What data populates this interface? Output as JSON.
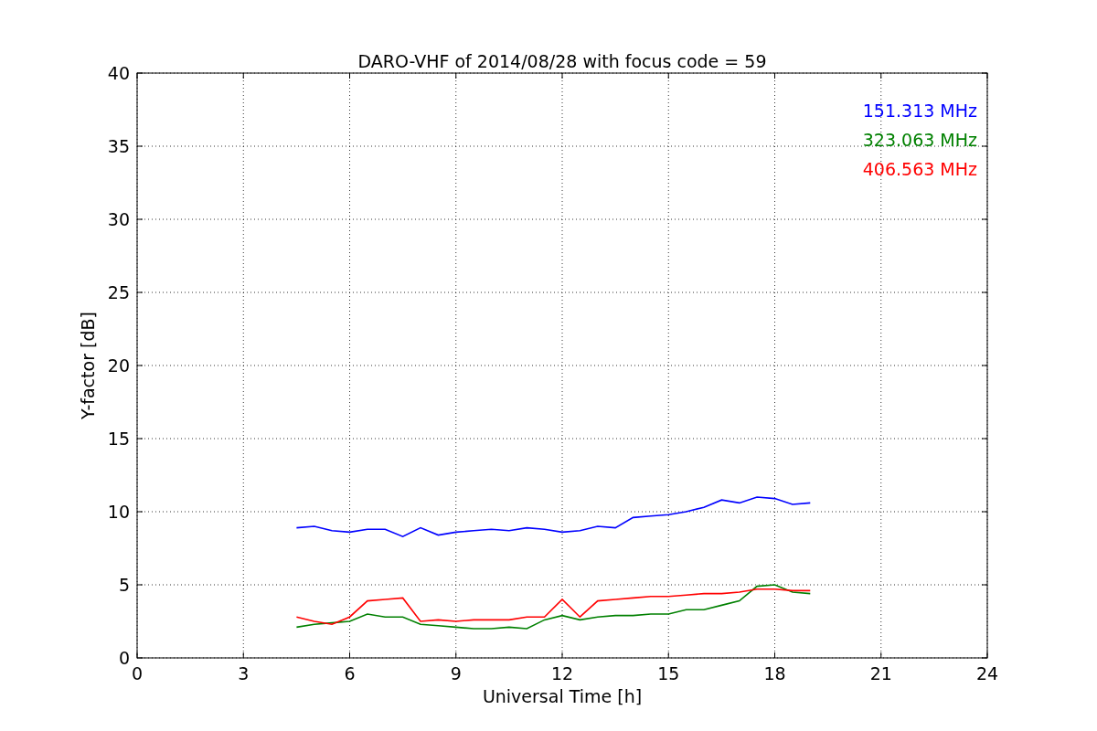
{
  "chart_data": {
    "type": "line",
    "title": "DARO-VHF of 2014/08/28 with focus code = 59",
    "xlabel": "Universal Time [h]",
    "ylabel": "Y-factor [dB]",
    "x": [
      4.5,
      5,
      5.5,
      6,
      6.5,
      7,
      7.5,
      8,
      8.5,
      9,
      9.5,
      10,
      10.5,
      11,
      11.5,
      12,
      12.5,
      13,
      13.5,
      14,
      14.5,
      15,
      15.5,
      16,
      16.5,
      17,
      17.5,
      18,
      18.5,
      19
    ],
    "series": [
      {
        "name": "151.313 MHz",
        "color": "#0000ff",
        "values": [
          8.9,
          9.0,
          8.7,
          8.6,
          8.8,
          8.8,
          8.3,
          8.9,
          8.4,
          8.6,
          8.7,
          8.8,
          8.7,
          8.9,
          8.8,
          8.6,
          8.7,
          9.0,
          8.9,
          9.6,
          9.7,
          9.8,
          10.0,
          10.3,
          10.8,
          10.6,
          11.0,
          10.9,
          10.5,
          10.6
        ]
      },
      {
        "name": "323.063 MHz",
        "color": "#008000",
        "values": [
          2.1,
          2.3,
          2.4,
          2.5,
          3.0,
          2.8,
          2.8,
          2.3,
          2.2,
          2.1,
          2.0,
          2.0,
          2.1,
          2.0,
          2.6,
          2.9,
          2.6,
          2.8,
          2.9,
          2.9,
          3.0,
          3.0,
          3.3,
          3.3,
          3.6,
          3.9,
          4.9,
          5.0,
          4.5,
          4.4
        ]
      },
      {
        "name": "406.563 MHz",
        "color": "#ff0000",
        "values": [
          2.8,
          2.5,
          2.3,
          2.8,
          3.9,
          4.0,
          4.1,
          2.5,
          2.6,
          2.5,
          2.6,
          2.6,
          2.6,
          2.8,
          2.8,
          4.0,
          2.8,
          3.9,
          4.0,
          4.1,
          4.2,
          4.2,
          4.3,
          4.4,
          4.4,
          4.5,
          4.7,
          4.7,
          4.6,
          4.6
        ]
      }
    ],
    "grid": true,
    "xlim": [
      0,
      24
    ],
    "ylim": [
      0,
      40
    ],
    "xticks": [
      0,
      3,
      6,
      9,
      12,
      15,
      18,
      21,
      24
    ],
    "yticks": [
      0,
      5,
      10,
      15,
      20,
      25,
      30,
      35,
      40
    ]
  }
}
